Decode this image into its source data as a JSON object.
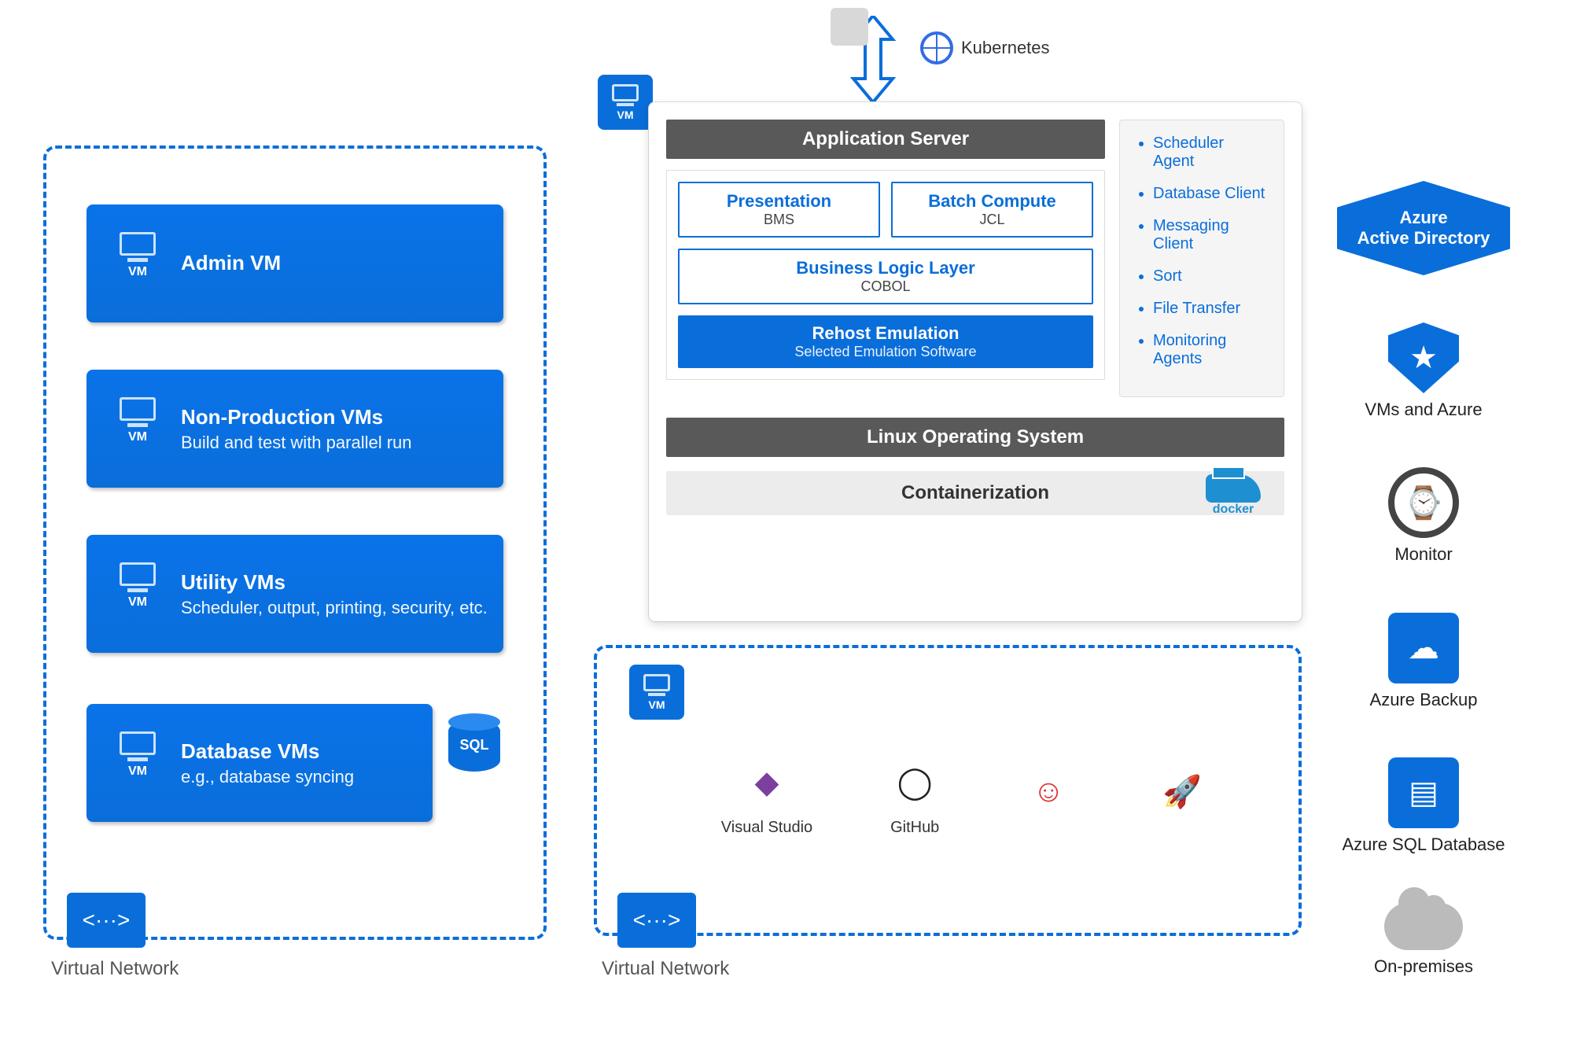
{
  "kubernetes_label": "Kubernetes",
  "virtual_network_label": "Virtual Network",
  "left_vms": [
    {
      "title": "Admin VM",
      "subtitle": null
    },
    {
      "title": "Non-Production VMs",
      "subtitle": "Build and test with parallel run"
    },
    {
      "title": "Utility VMs",
      "subtitle": "Scheduler, output, printing, security, etc."
    },
    {
      "title": "Database VMs",
      "subtitle": "e.g., database syncing"
    }
  ],
  "sql_label": "SQL",
  "app_server": {
    "header": "Application Server",
    "presentation": {
      "title": "Presentation",
      "sub": "BMS"
    },
    "batch": {
      "title": "Batch Compute",
      "sub": "JCL"
    },
    "logic": {
      "title": "Business Logic Layer",
      "sub": "COBOL"
    },
    "rehost": {
      "title": "Rehost Emulation",
      "sub": "Selected Emulation Software"
    },
    "linux": "Linux Operating System",
    "containerization": "Containerization"
  },
  "side_list": [
    "Scheduler Agent",
    "Database Client",
    "Messaging Client",
    "Sort",
    "File Transfer",
    "Monitoring Agents"
  ],
  "docker_label": "docker",
  "dev_tools": {
    "vs": "Visual Studio",
    "github": "GitHub",
    "jenkins": "",
    "pipelines": ""
  },
  "vm_badge_label": "VM",
  "vnet_badge": "<···>",
  "azure_right": {
    "head_line1": "Azure",
    "head_line2": "Active Directory",
    "items": [
      "VMs and Azure",
      "Monitor",
      "Azure Backup",
      "Azure SQL Database"
    ],
    "on_prem": "On-premises"
  }
}
